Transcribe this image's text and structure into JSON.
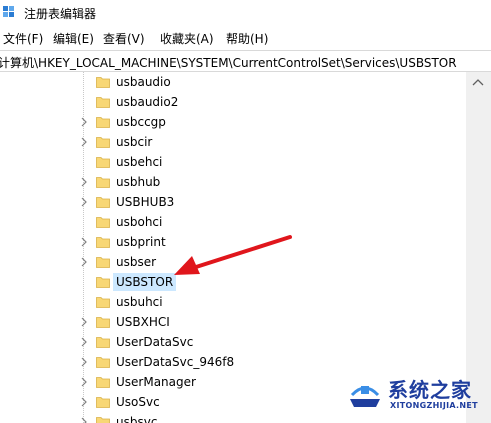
{
  "window": {
    "title": "注册表编辑器"
  },
  "menu": [
    {
      "label": "文件(F)"
    },
    {
      "label": "编辑(E)"
    },
    {
      "label": "查看(V)"
    },
    {
      "label": "收藏夹(A)"
    },
    {
      "label": "帮助(H)"
    }
  ],
  "address": {
    "path": "计算机\\HKEY_LOCAL_MACHINE\\SYSTEM\\CurrentControlSet\\Services\\USBSTOR"
  },
  "tree": {
    "items": [
      {
        "label": "usbaudio",
        "expandable": false
      },
      {
        "label": "usbaudio2",
        "expandable": false
      },
      {
        "label": "usbccgp",
        "expandable": true
      },
      {
        "label": "usbcir",
        "expandable": true
      },
      {
        "label": "usbehci",
        "expandable": false
      },
      {
        "label": "usbhub",
        "expandable": true
      },
      {
        "label": "USBHUB3",
        "expandable": true
      },
      {
        "label": "usbohci",
        "expandable": false
      },
      {
        "label": "usbprint",
        "expandable": true
      },
      {
        "label": "usbser",
        "expandable": true
      },
      {
        "label": "USBSTOR",
        "expandable": false,
        "selected": true
      },
      {
        "label": "usbuhci",
        "expandable": false
      },
      {
        "label": "USBXHCI",
        "expandable": true
      },
      {
        "label": "UserDataSvc",
        "expandable": true
      },
      {
        "label": "UserDataSvc_946f8",
        "expandable": true
      },
      {
        "label": "UserManager",
        "expandable": true
      },
      {
        "label": "UsoSvc",
        "expandable": true
      },
      {
        "label": "usbsvc",
        "expandable": true
      }
    ]
  },
  "watermark": {
    "name": "系统之家",
    "url": "XITONGZHIJIA.NET"
  },
  "colors": {
    "selection": "#cce8ff",
    "folder": "#f8d775",
    "arrow": "#e0161c",
    "watermark": "#1f3e9e"
  }
}
